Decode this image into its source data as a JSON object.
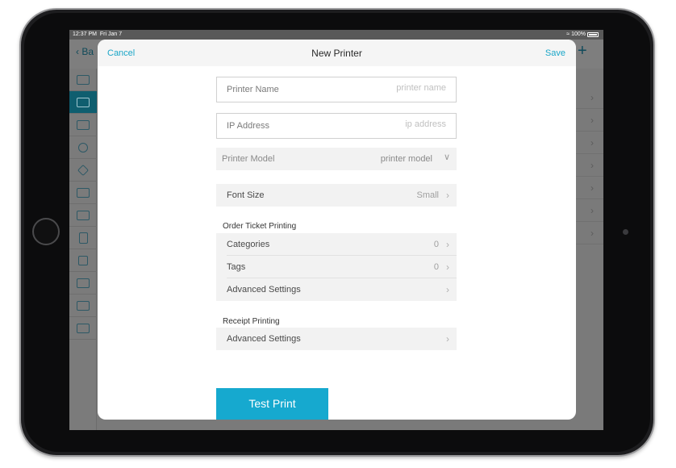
{
  "status_bar": {
    "time": "12:37 PM",
    "date": "Fri Jan 7",
    "battery": "100%"
  },
  "background": {
    "back_label": "Ba",
    "plus_icon": "+"
  },
  "modal": {
    "title": "New Printer",
    "cancel_label": "Cancel",
    "save_label": "Save",
    "fields": [
      {
        "label": "Printer Name",
        "placeholder": "printer name",
        "value": ""
      },
      {
        "label": "IP Address",
        "placeholder": "ip address",
        "value": ""
      }
    ],
    "printer_model": {
      "label": "Printer Model",
      "value": "printer model"
    },
    "font_size": {
      "label": "Font Size",
      "value": "Small"
    },
    "order_ticket": {
      "title": "Order Ticket Printing",
      "rows": [
        {
          "label": "Categories",
          "value": "0"
        },
        {
          "label": "Tags",
          "value": "0"
        },
        {
          "label": "Advanced Settings",
          "value": ""
        }
      ]
    },
    "receipt": {
      "title": "Receipt Printing",
      "rows": [
        {
          "label": "Advanced Settings",
          "value": ""
        }
      ]
    },
    "test_print_label": "Test Print"
  },
  "colors": {
    "accent": "#16a9cf",
    "link": "#1aa6c8",
    "sidebar_active": "#0f5e6f"
  }
}
